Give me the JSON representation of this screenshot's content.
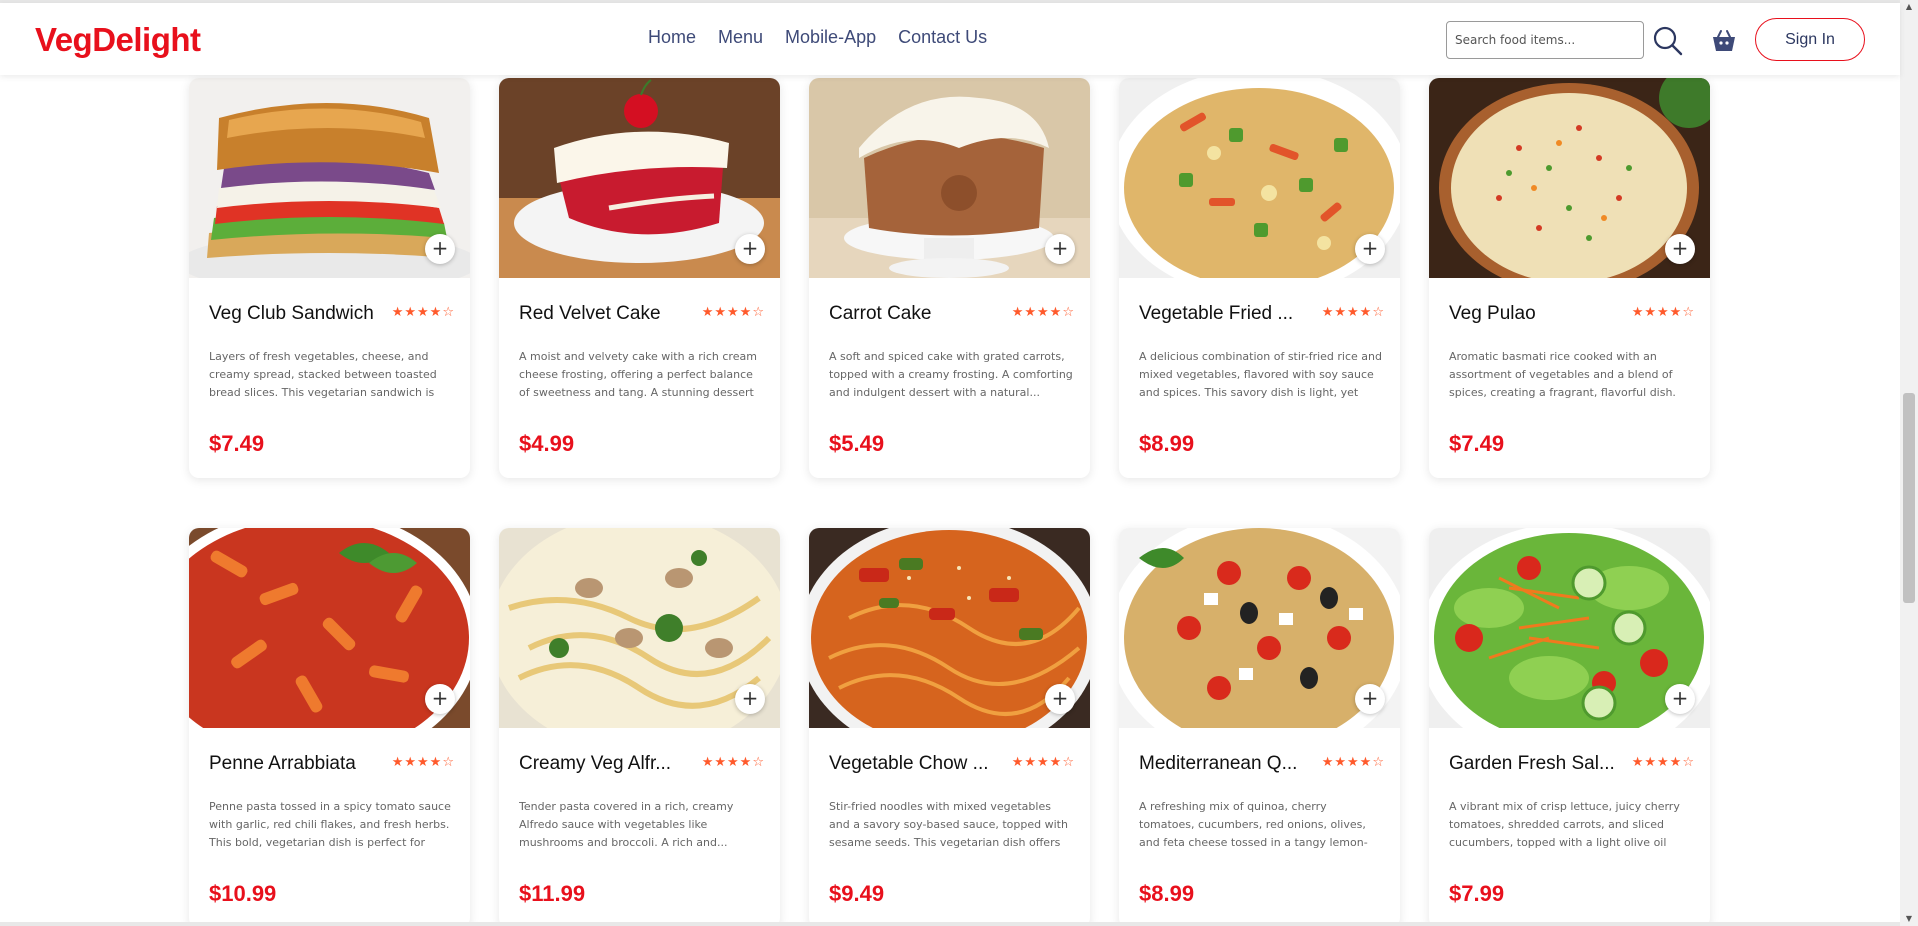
{
  "brand": {
    "name": "VegDelight"
  },
  "nav": {
    "links": [
      "Home",
      "Menu",
      "Mobile-App",
      "Contact Us"
    ]
  },
  "search": {
    "placeholder": "Search food items...",
    "icon": "search-icon"
  },
  "cart": {
    "icon": "basket-icon"
  },
  "signin": {
    "label": "Sign In"
  },
  "colors": {
    "accent": "#e8101c",
    "nav_text": "#3e4a78",
    "star": "#ff5a2c"
  },
  "add_label": "+",
  "items": [
    {
      "name": "Veg Club Sandwich",
      "rating": "★★★★☆",
      "desc": "Layers of fresh vegetables, cheese, and creamy spread, stacked between toasted bread slices. This vegetarian sandwich is a...",
      "price": "$7.49"
    },
    {
      "name": "Red Velvet Cake",
      "rating": "★★★★☆",
      "desc": "A moist and velvety cake with a rich cream cheese frosting, offering a perfect balance of sweetness and tang. A stunning dessert for...",
      "price": "$4.99"
    },
    {
      "name": "Carrot Cake",
      "rating": "★★★★☆",
      "desc": "A soft and spiced cake with grated carrots, topped with a creamy frosting. A comforting and indulgent dessert with a natural...",
      "price": "$5.49"
    },
    {
      "name": "Vegetable Fried ...",
      "rating": "★★★★☆",
      "desc": "A delicious combination of stir-fried rice and mixed vegetables, flavored with soy sauce and spices. This savory dish is light, yet fillin...",
      "price": "$8.99"
    },
    {
      "name": "Veg Pulao",
      "rating": "★★★★☆",
      "desc": "Aromatic basmati rice cooked with an assortment of vegetables and a blend of spices, creating a fragrant, flavorful dish. A...",
      "price": "$7.49"
    },
    {
      "name": "Penne Arrabbiata",
      "rating": "★★★★☆",
      "desc": "Penne pasta tossed in a spicy tomato sauce with garlic, red chili flakes, and fresh herbs. This bold, vegetarian dish is perfect for tho...",
      "price": "$10.99"
    },
    {
      "name": "Creamy Veg Alfr...",
      "rating": "★★★★☆",
      "desc": "Tender pasta covered in a rich, creamy Alfredo sauce with vegetables like mushrooms and broccoli. A rich and...",
      "price": "$11.99"
    },
    {
      "name": "Vegetable Chow ...",
      "rating": "★★★★☆",
      "desc": "Stir-fried noodles with mixed vegetables and a savory soy-based sauce, topped with sesame seeds. This vegetarian dish offers a...",
      "price": "$9.49"
    },
    {
      "name": "Mediterranean Q...",
      "rating": "★★★★☆",
      "desc": "A refreshing mix of quinoa, cherry tomatoes, cucumbers, red onions, olives, and feta cheese tossed in a tangy lemon-herb...",
      "price": "$8.99"
    },
    {
      "name": "Garden Fresh Sal...",
      "rating": "★★★★☆",
      "desc": "A vibrant mix of crisp lettuce, juicy cherry tomatoes, shredded carrots, and sliced cucumbers, topped with a light olive oil and...",
      "price": "$7.99"
    }
  ]
}
